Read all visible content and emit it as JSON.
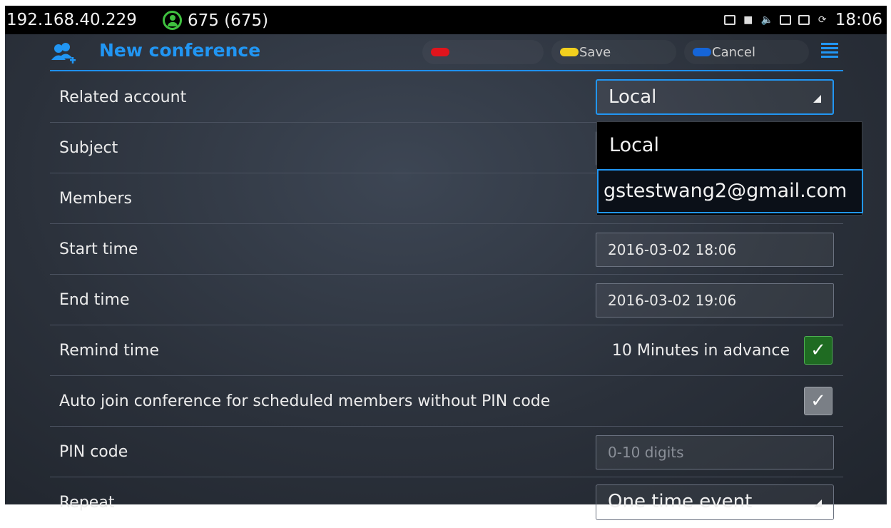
{
  "status_bar": {
    "ip": "192.168.40.229",
    "account": "675 (675)",
    "time": "18:06",
    "icons": [
      "image-icon",
      "bag-icon",
      "volume-icon",
      "voicemail-icon",
      "battery-icon",
      "sync-icon"
    ]
  },
  "header": {
    "title": "New conference",
    "title_color": "#2196f3",
    "softkeys": [
      {
        "label": "",
        "color": "#e0141c"
      },
      {
        "label": "Save",
        "color": "#f2d01e"
      },
      {
        "label": "Cancel",
        "color": "#1565d8"
      }
    ]
  },
  "form": {
    "related_account": {
      "label": "Related account",
      "value": "Local"
    },
    "subject": {
      "label": "Subject"
    },
    "members": {
      "label": "Members"
    },
    "start_time": {
      "label": "Start time",
      "value": "2016-03-02 18:06"
    },
    "end_time": {
      "label": "End time",
      "value": "2016-03-02 19:06"
    },
    "remind_time": {
      "label": "Remind time",
      "value": "10 Minutes in advance",
      "checked": true
    },
    "auto_join": {
      "label": "Auto join conference for scheduled members without PIN code",
      "checked": true
    },
    "pin_code": {
      "label": "PIN code",
      "placeholder": "0-10 digits"
    },
    "repeat": {
      "label": "Repeat",
      "value": "One time event"
    }
  },
  "dropdown": {
    "options": [
      "Local",
      "gstestwang2@gmail.com"
    ],
    "highlighted_index": 1
  }
}
